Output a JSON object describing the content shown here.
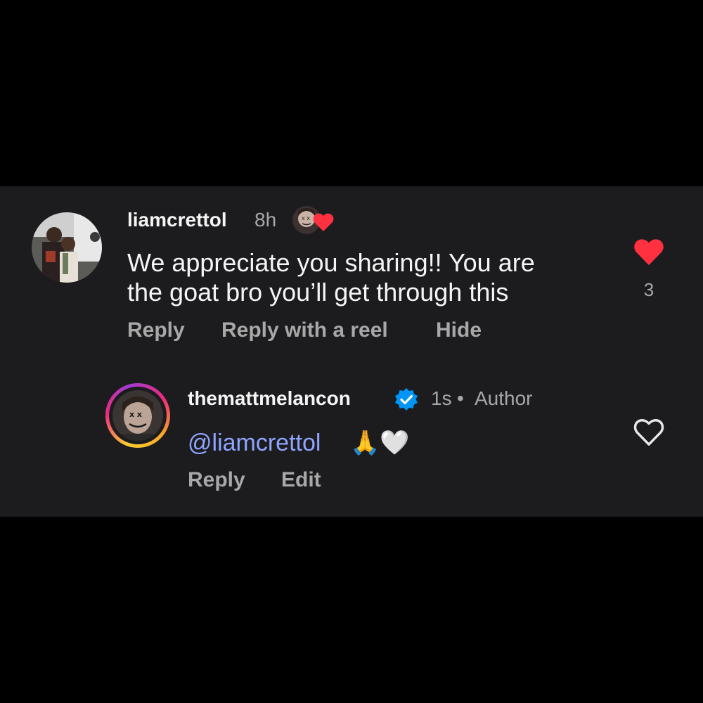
{
  "comment": {
    "username": "liamcrettol",
    "time": "8h",
    "text_line1": "We appreciate you sharing!! You are",
    "text_line2": "the goat bro you’ll get through this",
    "like_count": "3",
    "liked": true,
    "actions": {
      "reply": "Reply",
      "reply_reel": "Reply with a reel",
      "hide": "Hide"
    }
  },
  "reply": {
    "username": "themattmelancon",
    "verified": true,
    "time": "1s",
    "separator": "•",
    "role": "Author",
    "mention": "@liamcrettol",
    "emoji_text": "🙏🤍",
    "liked": false,
    "actions": {
      "reply": "Reply",
      "edit": "Edit"
    }
  },
  "colors": {
    "panel_bg": "#1c1c1f",
    "like_red": "#ff3040",
    "verified_blue": "#0095f6",
    "mention_blue": "#8fa4ff"
  }
}
